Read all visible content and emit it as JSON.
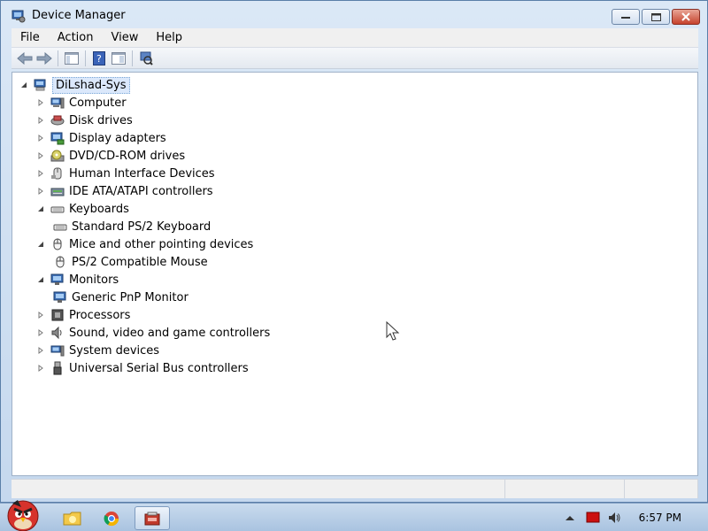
{
  "window": {
    "title": "Device Manager"
  },
  "menu": [
    "File",
    "Action",
    "View",
    "Help"
  ],
  "tree": {
    "root": "DiLshad-Sys",
    "items": [
      {
        "label": "Computer",
        "icon": "computer-icon",
        "state": "collapsed"
      },
      {
        "label": "Disk drives",
        "icon": "disk-drive-icon",
        "state": "collapsed"
      },
      {
        "label": "Display adapters",
        "icon": "display-adapter-icon",
        "state": "collapsed"
      },
      {
        "label": "DVD/CD-ROM drives",
        "icon": "dvd-drive-icon",
        "state": "collapsed"
      },
      {
        "label": "Human Interface Devices",
        "icon": "hid-icon",
        "state": "collapsed"
      },
      {
        "label": "IDE ATA/ATAPI controllers",
        "icon": "ide-controller-icon",
        "state": "collapsed"
      },
      {
        "label": "Keyboards",
        "icon": "keyboard-icon",
        "state": "expanded"
      },
      {
        "label": "Standard PS/2 Keyboard",
        "icon": "keyboard-icon",
        "state": "child"
      },
      {
        "label": "Mice and other pointing devices",
        "icon": "mouse-icon",
        "state": "expanded"
      },
      {
        "label": "PS/2 Compatible Mouse",
        "icon": "mouse-icon",
        "state": "child"
      },
      {
        "label": "Monitors",
        "icon": "monitor-icon",
        "state": "expanded"
      },
      {
        "label": "Generic PnP Monitor",
        "icon": "monitor-icon",
        "state": "child"
      },
      {
        "label": "Processors",
        "icon": "processor-icon",
        "state": "collapsed"
      },
      {
        "label": "Sound, video and game controllers",
        "icon": "speaker-icon",
        "state": "collapsed"
      },
      {
        "label": "System devices",
        "icon": "system-device-icon",
        "state": "collapsed"
      },
      {
        "label": "Universal Serial Bus controllers",
        "icon": "usb-icon",
        "state": "collapsed"
      }
    ]
  },
  "taskbar": {
    "clock": "6:57 PM"
  }
}
